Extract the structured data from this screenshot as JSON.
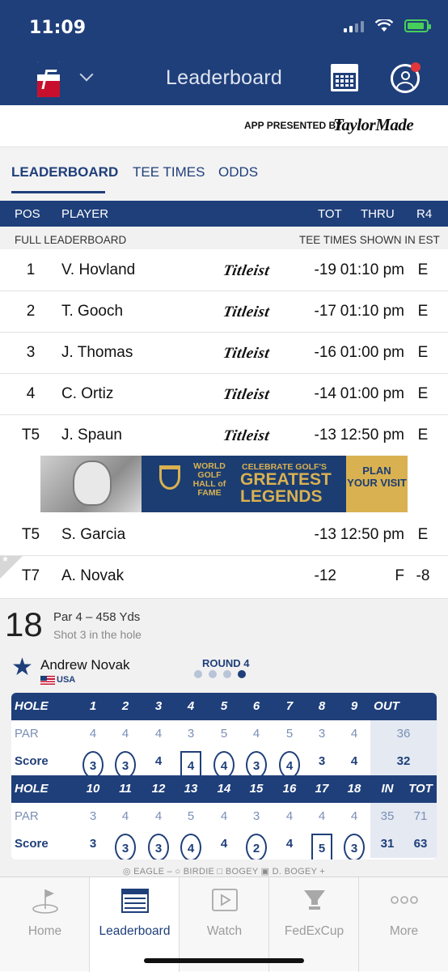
{
  "status": {
    "time": "11:09"
  },
  "app": {
    "title": "Leaderboard"
  },
  "sponsor": {
    "text": "APP PRESENTED BY",
    "brand": "TaylorMade"
  },
  "tabs": [
    "LEADERBOARD",
    "TEE TIMES",
    "ODDS"
  ],
  "columns": {
    "pos": "POS",
    "player": "PLAYER",
    "tot": "TOT",
    "thru": "THRU",
    "r4": "R4"
  },
  "subheader": {
    "left": "FULL LEADERBOARD",
    "right": "TEE TIMES SHOWN IN EST"
  },
  "rows": [
    {
      "pos": "1",
      "player": "V. Hovland",
      "sponsor": "Titleist",
      "tot": "-19",
      "thru": "01:10 pm",
      "r4": "E"
    },
    {
      "pos": "2",
      "player": "T. Gooch",
      "sponsor": "Titleist",
      "tot": "-17",
      "thru": "01:10 pm",
      "r4": "E"
    },
    {
      "pos": "3",
      "player": "J. Thomas",
      "sponsor": "Titleist",
      "tot": "-16",
      "thru": "01:00 pm",
      "r4": "E"
    },
    {
      "pos": "4",
      "player": "C. Ortiz",
      "sponsor": "Titleist",
      "tot": "-14",
      "thru": "01:00 pm",
      "r4": "E"
    },
    {
      "pos": "T5",
      "player": "J. Spaun",
      "sponsor": "Titleist",
      "tot": "-13",
      "thru": "12:50 pm",
      "r4": "E"
    },
    {
      "pos": "T5",
      "player": "S. Garcia",
      "sponsor": "",
      "tot": "-13",
      "thru": "12:50 pm",
      "r4": "E"
    },
    {
      "pos": "T7",
      "player": "A. Novak",
      "sponsor": "",
      "tot": "-12",
      "thru": "F",
      "r4": "-8"
    }
  ],
  "ad": {
    "hall": "WORLD GOLF HALL of FAME",
    "line1": "CELEBRATE GOLF'S",
    "line2": "GREATEST",
    "line3": "LEGENDS",
    "cta": "PLAN YOUR VISIT"
  },
  "hole": {
    "number": "18",
    "par": "Par 4 – 458 Yds",
    "shot": "Shot 3 in the hole"
  },
  "player": {
    "name": "Andrew Novak",
    "country": "USA",
    "round": "ROUND 4",
    "round_index": 4,
    "round_total": 4
  },
  "scorecard": {
    "front": {
      "hole_label": "HOLE",
      "holes": [
        "1",
        "2",
        "3",
        "4",
        "5",
        "6",
        "7",
        "8",
        "9"
      ],
      "total_label": "OUT",
      "par_label": "PAR",
      "par": [
        "4",
        "4",
        "4",
        "3",
        "5",
        "4",
        "5",
        "3",
        "4"
      ],
      "par_total": "36",
      "score_label": "Score",
      "score": [
        "3",
        "3",
        "4",
        "4",
        "4",
        "3",
        "4",
        "3",
        "4"
      ],
      "score_mark": [
        "circle",
        "circle",
        "",
        "square",
        "circle",
        "circle",
        "circle",
        "",
        ""
      ],
      "score_total": "32"
    },
    "back": {
      "hole_label": "HOLE",
      "holes": [
        "10",
        "11",
        "12",
        "13",
        "14",
        "15",
        "16",
        "17",
        "18"
      ],
      "in_label": "IN",
      "tot_label": "TOT",
      "par_label": "PAR",
      "par": [
        "3",
        "4",
        "4",
        "5",
        "4",
        "3",
        "4",
        "4",
        "4"
      ],
      "par_in": "35",
      "par_tot": "71",
      "score_label": "Score",
      "score": [
        "3",
        "3",
        "3",
        "4",
        "4",
        "2",
        "4",
        "5",
        "3"
      ],
      "score_mark": [
        "",
        "circle",
        "circle",
        "circle",
        "",
        "circle",
        "",
        "square",
        "circle"
      ],
      "score_in": "31",
      "score_tot": "63"
    }
  },
  "legend": "◎ EAGLE –  ○ BIRDIE  □ BOGEY  ▣ D. BOGEY +",
  "nav": [
    "Home",
    "Leaderboard",
    "Watch",
    "FedExCup",
    "More"
  ],
  "colors": {
    "primary": "#1f3f7a",
    "accent_red": "#c8102e",
    "gold": "#d9b151"
  }
}
